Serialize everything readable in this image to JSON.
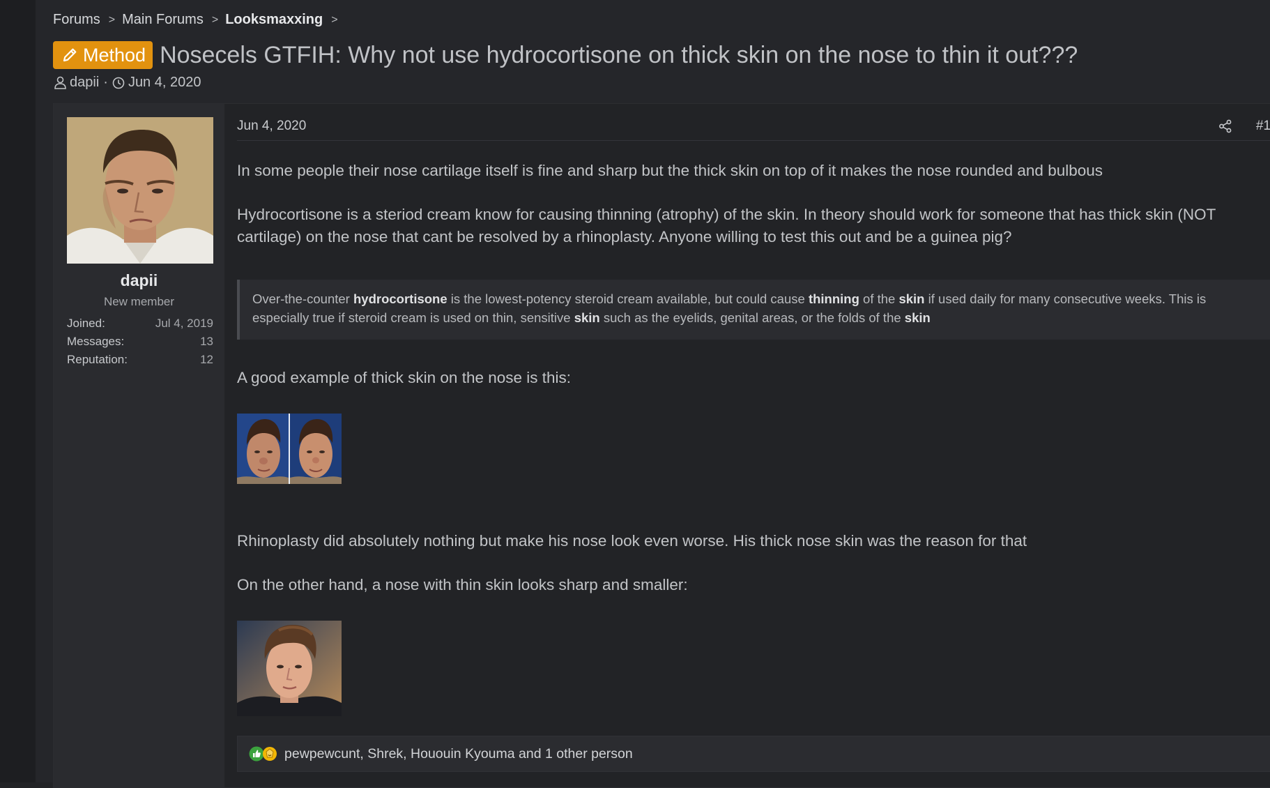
{
  "breadcrumb": {
    "items": [
      "Forums",
      "Main Forums",
      "Looksmaxxing"
    ]
  },
  "thread": {
    "prefix": "Method",
    "title": "Nosecels GTFIH: Why not use hydrocortisone on thick skin on the nose to thin it out???",
    "author": "dapii",
    "meta_sep": "·",
    "date": "Jun 4, 2020"
  },
  "user": {
    "name": "dapii",
    "title": "New member",
    "stats": [
      {
        "label": "Joined:",
        "value": "Jul 4, 2019"
      },
      {
        "label": "Messages:",
        "value": "13"
      },
      {
        "label": "Reputation:",
        "value": "12"
      }
    ]
  },
  "post": {
    "date": "Jun 4, 2020",
    "number": "#1",
    "p1": "In some people their nose cartilage itself is fine and sharp but the thick skin on top of it makes the nose rounded and bulbous",
    "p2": "Hydrocortisone is a steriod cream know for causing thinning (atrophy) of the skin. In theory should work for someone that has thick skin (NOT cartilage) on the nose that cant be resolved by a rhinoplasty. Anyone willing to test this out and be a guinea pig?",
    "quote": {
      "t1": "Over-the-counter ",
      "b1": "hydrocortisone",
      "t2": " is the lowest-potency steroid cream available, but could cause ",
      "b2": "thinning",
      "t3": " of the ",
      "b3": "skin",
      "t4": " if used daily for many consecutive weeks. This is especially true if steroid cream is used on thin, sensitive ",
      "b4": "skin",
      "t5": " such as the eyelids, genital areas, or the folds of the ",
      "b5": "skin"
    },
    "p3": "A good example of thick skin on the nose is this:",
    "p4": "Rhinoplasty did absolutely nothing but make his nose look even worse. His thick nose skin was the reason for that",
    "p5": "On the other hand, a nose with thin skin looks sharp and smaller:",
    "reactions_text": "pewpewcunt, Shrek, Hououin Kyouma and 1 other person"
  },
  "colors": {
    "prefix_bg": "#e2920f",
    "page_bg": "#25262a"
  }
}
